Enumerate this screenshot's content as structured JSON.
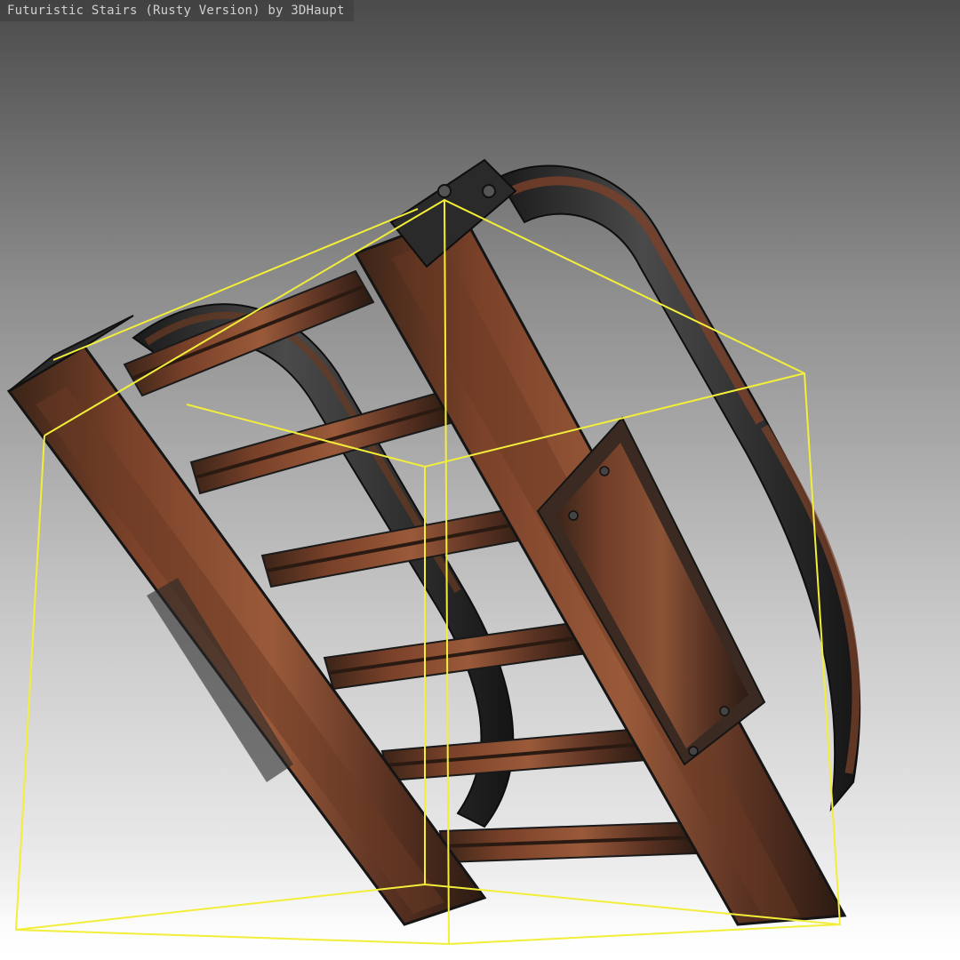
{
  "viewer": {
    "title": "Futuristic Stairs (Rusty Version) by 3DHaupt"
  },
  "scene": {
    "background_colors": [
      "#4b4b4b",
      "#c9c9c9",
      "#ffffff"
    ],
    "bounding_box_color": "#f2ee3a",
    "rust_color": "#8a4a2c",
    "dark_metal_color": "#2a2a2a"
  }
}
